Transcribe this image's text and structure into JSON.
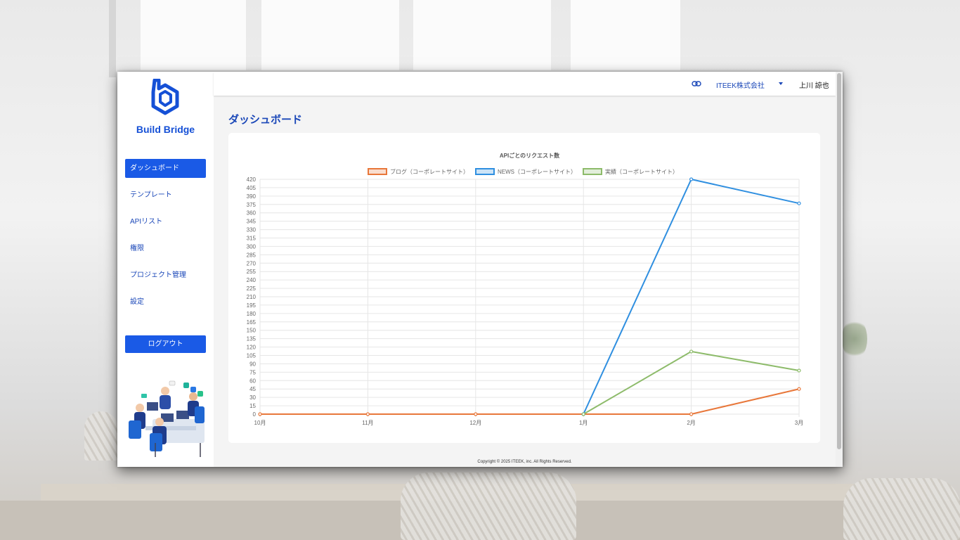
{
  "brand": {
    "name": "Build Bridge"
  },
  "sidebar": {
    "items": [
      {
        "label": "ダッシュボード",
        "active": true
      },
      {
        "label": "テンプレート"
      },
      {
        "label": "APIリスト"
      },
      {
        "label": "権限"
      },
      {
        "label": "プロジェクト管理"
      },
      {
        "label": "設定"
      }
    ],
    "logout_label": "ログアウト"
  },
  "header": {
    "link_icon": "link-icon",
    "company": "ITEEK株式会社",
    "user": "上川 諒也"
  },
  "main": {
    "title": "ダッシュボード"
  },
  "footer": {
    "copyright": "Copyright © 2025 ITEEK, inc. All Rights Reserved."
  },
  "colors": {
    "accent": "#1a5ae6",
    "orange": "#e8773a",
    "blue": "#2f8fe0",
    "green": "#8dbb6a"
  },
  "chart_data": {
    "type": "line",
    "title": "APIごとのリクエスト数",
    "categories": [
      "10月",
      "11月",
      "12月",
      "1月",
      "2月",
      "3月"
    ],
    "ylim": [
      0,
      420
    ],
    "yticks": [
      0,
      15,
      30,
      45,
      60,
      75,
      90,
      105,
      120,
      135,
      150,
      165,
      180,
      195,
      210,
      225,
      240,
      255,
      270,
      285,
      300,
      315,
      330,
      345,
      360,
      375,
      390,
      405,
      420
    ],
    "grid": true,
    "legend": "top",
    "series": [
      {
        "name": "ブログ（コーポレートサイト）",
        "color": "#e8773a",
        "values": [
          0,
          0,
          0,
          0,
          0,
          45
        ]
      },
      {
        "name": "NEWS（コーポレートサイト）",
        "color": "#2f8fe0",
        "values": [
          null,
          null,
          null,
          0,
          420,
          377
        ]
      },
      {
        "name": "実績（コーポレートサイト）",
        "color": "#8dbb6a",
        "values": [
          null,
          null,
          null,
          0,
          112,
          78
        ]
      }
    ]
  }
}
